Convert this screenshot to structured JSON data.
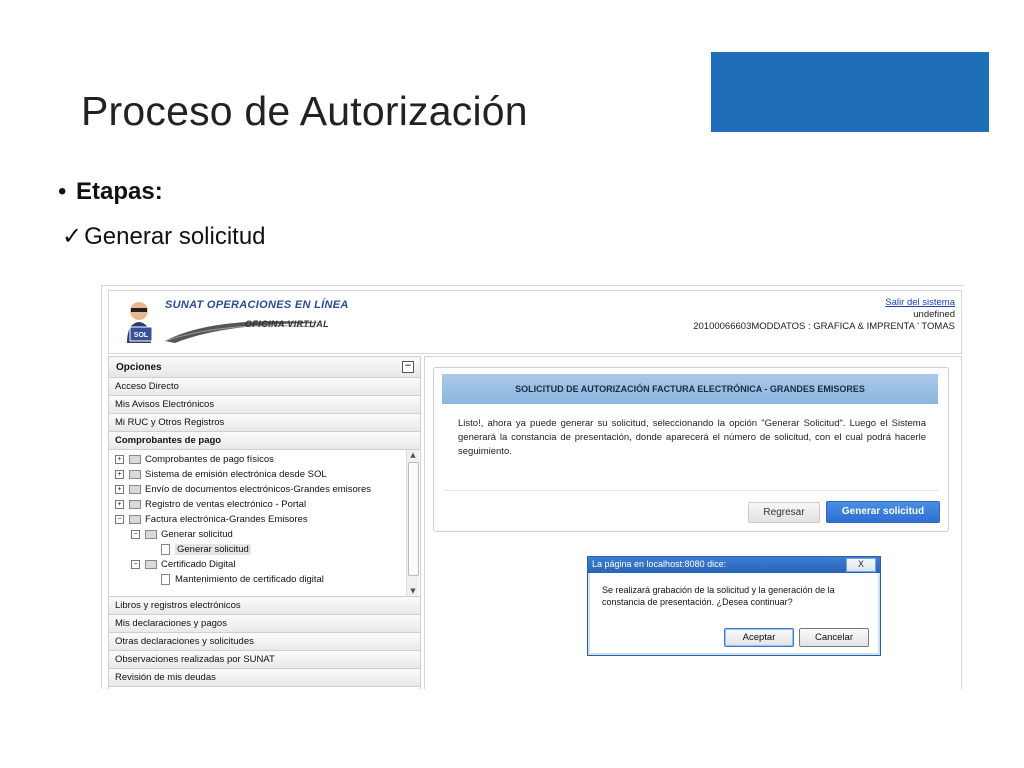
{
  "slide": {
    "title": "Proceso de Autorización",
    "bullet_label": "Etapas:",
    "check_glyph": "✓",
    "check_item": "Generar solicitud",
    "accent_color": "#1f6fb8"
  },
  "portal": {
    "logo_title": "SUNAT OPERACIONES EN LÍNEA",
    "logo_subtitle": "OFICINA VIRTUAL",
    "logo_badge": "SOL",
    "logout_link": "Salir del sistema",
    "user_line1": "undefined",
    "user_line2": "20100066603MODDATOS : GRAFICA & IMPRENTA ' TOMAS"
  },
  "sidebar": {
    "header": "Opciones",
    "collapse_glyph": "−",
    "top_items": [
      {
        "label": "Acceso Directo"
      },
      {
        "label": "Mis Avisos Electrónicos"
      },
      {
        "label": "Mi RUC y Otros Registros"
      },
      {
        "label": "Comprobantes de pago"
      }
    ],
    "tree": [
      {
        "label": "Comprobantes de pago físicos",
        "toggle": "+"
      },
      {
        "label": "Sistema de emisión electrónica desde SOL",
        "toggle": "+"
      },
      {
        "label": "Envío de documentos electrónicos-Grandes emisores",
        "toggle": "+"
      },
      {
        "label": "Registro de ventas electrónico - Portal",
        "toggle": "+"
      },
      {
        "label": "Factura electrónica-Grandes Emisores",
        "toggle": "−"
      },
      {
        "label": "Generar solicitud",
        "toggle": "−"
      },
      {
        "label": "Generar solicitud"
      },
      {
        "label": "Certificado Digital",
        "toggle": "−"
      },
      {
        "label": "Mantenimiento de certificado digital"
      }
    ],
    "bottom_items": [
      {
        "label": "Libros y registros electrónicos"
      },
      {
        "label": "Mis declaraciones y pagos"
      },
      {
        "label": "Otras declaraciones y solicitudes"
      },
      {
        "label": "Observaciones realizadas por SUNAT"
      },
      {
        "label": "Revisión de mis deudas"
      }
    ]
  },
  "main": {
    "card_title": "SOLICITUD DE AUTORIZACIÓN FACTURA ELECTRÓNICA - GRANDES EMISORES",
    "card_text": "Listo!, ahora ya puede generar su solicitud, seleccionando la opción \"Generar Solicitud\". Luego el Sistema generará la constancia de presentación, donde aparecerá el número de solicitud, con el cual podrá hacerle seguimiento.",
    "back_button": "Regresar",
    "generate_button": "Generar solicitud"
  },
  "dialog": {
    "title": "La página en localhost:8080 dice:",
    "close_glyph": "X",
    "message": "Se realizará grabación de la solicitud y la generación de la constancia de presentación. ¿Desea continuar?",
    "ok_button": "Aceptar",
    "cancel_button": "Cancelar"
  }
}
